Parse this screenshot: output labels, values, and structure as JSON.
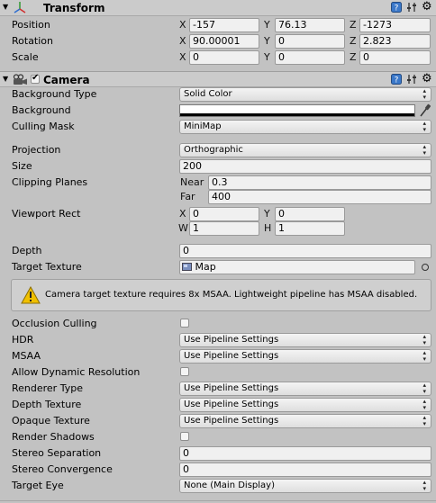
{
  "transform": {
    "title": "Transform",
    "position": {
      "label": "Position",
      "x": "-157",
      "y": "76.13",
      "z": "-1273"
    },
    "rotation": {
      "label": "Rotation",
      "x": "90.00001",
      "y": "0",
      "z": "2.823"
    },
    "scale": {
      "label": "Scale",
      "x": "0",
      "y": "0",
      "z": "0"
    },
    "axis_x": "X",
    "axis_y": "Y",
    "axis_z": "Z"
  },
  "camera": {
    "title": "Camera",
    "background_type": {
      "label": "Background Type",
      "value": "Solid Color"
    },
    "background": {
      "label": "Background",
      "color": "#ffffff"
    },
    "culling_mask": {
      "label": "Culling Mask",
      "value": "MiniMap"
    },
    "projection": {
      "label": "Projection",
      "value": "Orthographic"
    },
    "size": {
      "label": "Size",
      "value": "200"
    },
    "clipping_planes": {
      "label": "Clipping Planes",
      "near_label": "Near",
      "near": "0.3",
      "far_label": "Far",
      "far": "400"
    },
    "viewport_rect": {
      "label": "Viewport Rect",
      "x_label": "X",
      "x": "0",
      "y_label": "Y",
      "y": "0",
      "w_label": "W",
      "w": "1",
      "h_label": "H",
      "h": "1"
    },
    "depth": {
      "label": "Depth",
      "value": "0"
    },
    "target_texture": {
      "label": "Target Texture",
      "value": "Map"
    },
    "warning": "Camera target texture requires 8x MSAA. Lightweight pipeline has MSAA disabled.",
    "occlusion_culling": {
      "label": "Occlusion Culling"
    },
    "hdr": {
      "label": "HDR",
      "value": "Use Pipeline Settings"
    },
    "msaa": {
      "label": "MSAA",
      "value": "Use Pipeline Settings"
    },
    "allow_dynamic_resolution": {
      "label": "Allow Dynamic Resolution"
    },
    "renderer_type": {
      "label": "Renderer Type",
      "value": "Use Pipeline Settings"
    },
    "depth_texture": {
      "label": "Depth Texture",
      "value": "Use Pipeline Settings"
    },
    "opaque_texture": {
      "label": "Opaque Texture",
      "value": "Use Pipeline Settings"
    },
    "render_shadows": {
      "label": "Render Shadows"
    },
    "stereo_separation": {
      "label": "Stereo Separation",
      "value": "0"
    },
    "stereo_convergence": {
      "label": "Stereo Convergence",
      "value": "0"
    },
    "target_eye": {
      "label": "Target Eye",
      "value": "None (Main Display)"
    }
  },
  "colors": {
    "panel": "#c2c2c2",
    "warning_icon": "#f0c000",
    "help_icon": "#3b78c9"
  }
}
